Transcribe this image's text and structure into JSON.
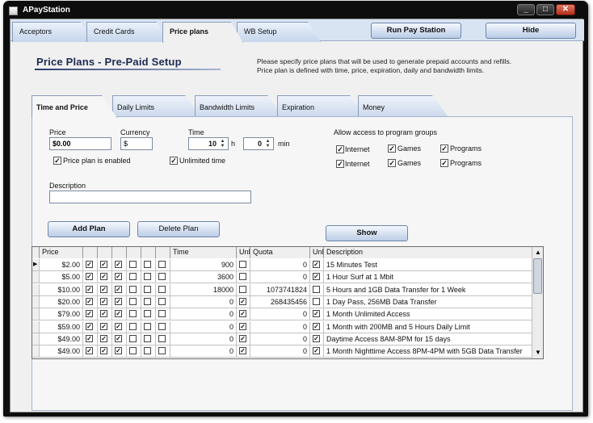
{
  "window": {
    "title": "APayStation",
    "minimize": "_",
    "maximize": "□",
    "close": "✕"
  },
  "top_tabs": [
    {
      "label": "Acceptors"
    },
    {
      "label": "Credit Cards"
    },
    {
      "label": "Price plans",
      "active": true
    },
    {
      "label": "WB Setup"
    }
  ],
  "header_buttons": {
    "run": "Run Pay Station",
    "hide": "Hide"
  },
  "page": {
    "title": "Price Plans - Pre-Paid Setup",
    "desc1": "Please specify price plans that will be used to generate prepaid accounts and refills.",
    "desc2": "Price plan is defined with time, price, expiration, daily and bandwidth limits."
  },
  "inner_tabs": [
    {
      "label": "Time and Price",
      "active": true
    },
    {
      "label": "Daily Limits"
    },
    {
      "label": "Bandwidth Limits"
    },
    {
      "label": "Expiration"
    },
    {
      "label": "Money"
    }
  ],
  "form": {
    "price_label": "Price",
    "price_value": "$0.00",
    "currency_label": "Currency",
    "currency_value": "$",
    "time_label": "Time",
    "hours_value": "10",
    "h_unit": "h",
    "minutes_value": "0",
    "min_unit": "min",
    "price_enabled_label": "Price plan is enabled",
    "unlimited_time_label": "Unlimited time",
    "description_label": "Description",
    "description_value": "",
    "groups_label": "Allow access to program groups",
    "groups": [
      [
        "Internet",
        "Games",
        "Programs"
      ],
      [
        "Internet",
        "Games",
        "Programs"
      ]
    ]
  },
  "buttons": {
    "add": "Add Plan",
    "delete": "Delete Plan",
    "show": "Show"
  },
  "grid": {
    "headers": {
      "price": "Price",
      "time": "Time",
      "unl": "Unl",
      "quota": "Quota",
      "unl2": "Unl",
      "description": "Description"
    },
    "rows": [
      {
        "price": "$2.00",
        "time": "900",
        "quota": "0",
        "description": "15 Minutes Test",
        "time_unl": false,
        "quota_unl": true
      },
      {
        "price": "$5.00",
        "time": "3600",
        "quota": "0",
        "description": "1 Hour Surf at 1 Mbit",
        "time_unl": false,
        "quota_unl": true
      },
      {
        "price": "$10.00",
        "time": "18000",
        "quota": "1073741824",
        "description": "5 Hours and 1GB Data Transfer for 1 Week",
        "time_unl": false,
        "quota_unl": false
      },
      {
        "price": "$20.00",
        "time": "0",
        "quota": "268435456",
        "description": "1 Day Pass, 256MB Data Transfer",
        "time_unl": true,
        "quota_unl": false
      },
      {
        "price": "$79.00",
        "time": "0",
        "quota": "0",
        "description": "1 Month Unlimited Access",
        "time_unl": true,
        "quota_unl": true
      },
      {
        "price": "$59.00",
        "time": "0",
        "quota": "0",
        "description": "1 Month with 200MB and 5 Hours Daily Limit",
        "time_unl": true,
        "quota_unl": true
      },
      {
        "price": "$49.00",
        "time": "0",
        "quota": "0",
        "description": "Daytime Access 8AM-8PM for 15 days",
        "time_unl": true,
        "quota_unl": true
      },
      {
        "price": "$49.00",
        "time": "0",
        "quota": "0",
        "description": "1 Month Nighttime Access 8PM-4PM with 5GB Data Transfer",
        "time_unl": true,
        "quota_unl": true
      }
    ]
  },
  "colors": {
    "title_blue": "#1e2a52",
    "tab_blue": "#c6d6ec"
  }
}
